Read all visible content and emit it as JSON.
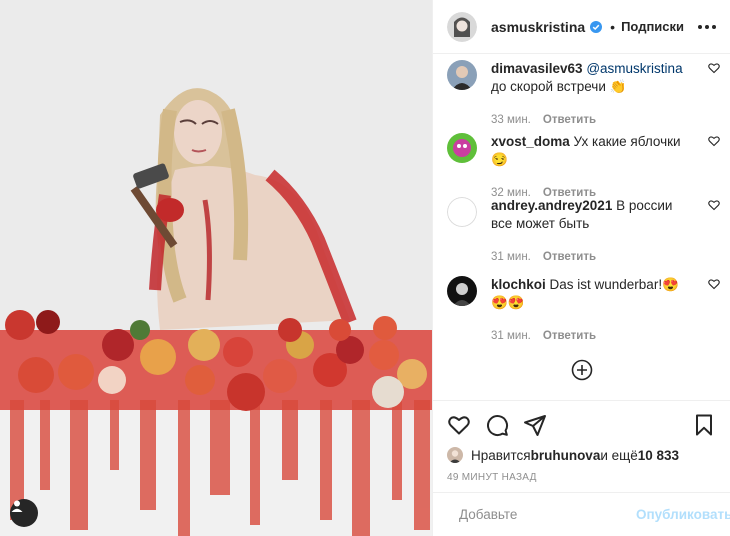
{
  "post": {
    "author": "asmuskristina",
    "separator": "•",
    "follow_label": "Подписки",
    "photo_icon": "user-tag-icon"
  },
  "comments": [
    {
      "user": "dimavasilev63",
      "mention": "@asmuskristina",
      "text": " до скорой встречи 👏",
      "time": "33 мин.",
      "reply": "Ответить"
    },
    {
      "user": "xvost_doma",
      "mention": "",
      "text": " Ух какие яблочки 😏",
      "time": "32 мин.",
      "reply": "Ответить"
    },
    {
      "user": "andrey.andrey2021",
      "mention": "",
      "text": " В россии все может быть",
      "time": "31 мин.",
      "reply": "Ответить"
    },
    {
      "user": "klochkoi",
      "mention": "",
      "text": " Das ist wunderbar!😍😍😍",
      "time": "31 мин.",
      "reply": "Ответить"
    }
  ],
  "likes": {
    "prefix": "Нравится ",
    "user": "bruhunova",
    "middle": " и ещё ",
    "count": "10 833"
  },
  "timestamp": "49 МИНУТ НАЗАД",
  "composer": {
    "placeholder": "Добавьте",
    "publish_label": "Опубликовать"
  },
  "colors": {
    "text": "#262626",
    "secondary": "#8e8e8e",
    "verified": "#3897f0",
    "publish_disabled": "#b2dffc",
    "mention": "#00376b"
  }
}
